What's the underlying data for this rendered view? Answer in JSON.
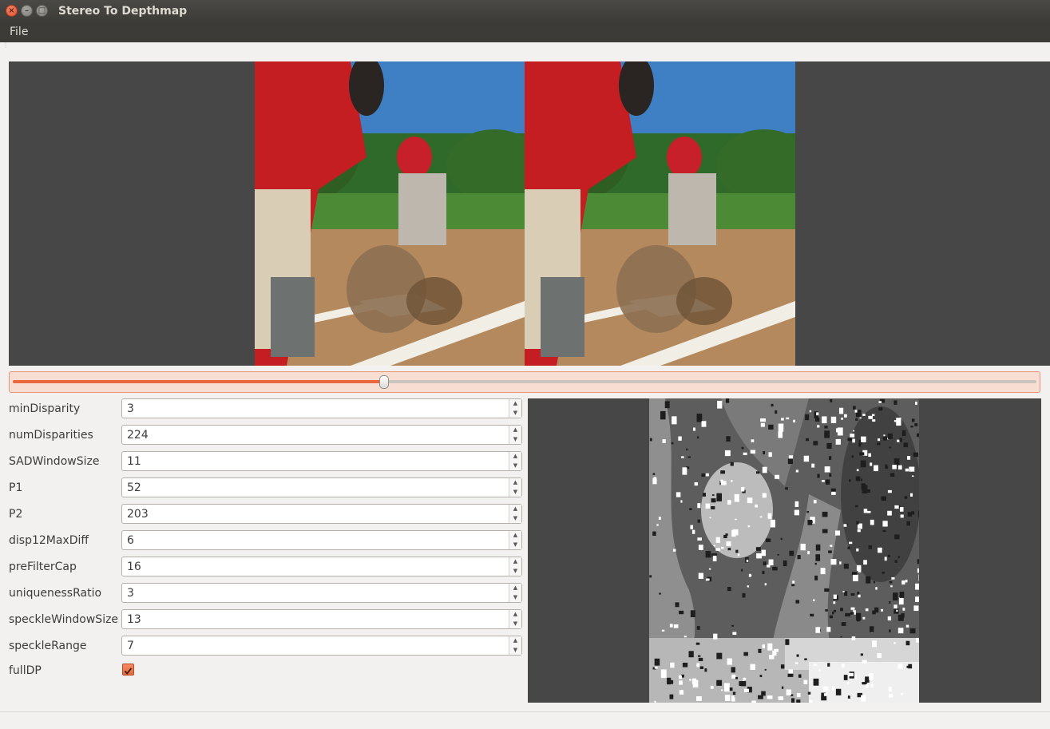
{
  "window": {
    "title": "Stereo To Depthmap"
  },
  "menu": {
    "file": "File"
  },
  "slider": {
    "value_fraction": 0.363
  },
  "params": [
    {
      "label": "minDisparity",
      "value": "3"
    },
    {
      "label": "numDisparities",
      "value": "224"
    },
    {
      "label": "SADWindowSize",
      "value": "11"
    },
    {
      "label": "P1",
      "value": "52"
    },
    {
      "label": "P2",
      "value": "203"
    },
    {
      "label": "disp12MaxDiff",
      "value": "6"
    },
    {
      "label": "preFilterCap",
      "value": "16"
    },
    {
      "label": "uniquenessRatio",
      "value": "3"
    },
    {
      "label": "speckleWindowSize",
      "value": "13"
    },
    {
      "label": "speckleRange",
      "value": "7"
    }
  ],
  "fullDP": {
    "label": "fullDP",
    "checked": true
  },
  "colors": {
    "accent": "#e9683e",
    "viewport": "#474747",
    "titlebar": "#3c3b37"
  }
}
